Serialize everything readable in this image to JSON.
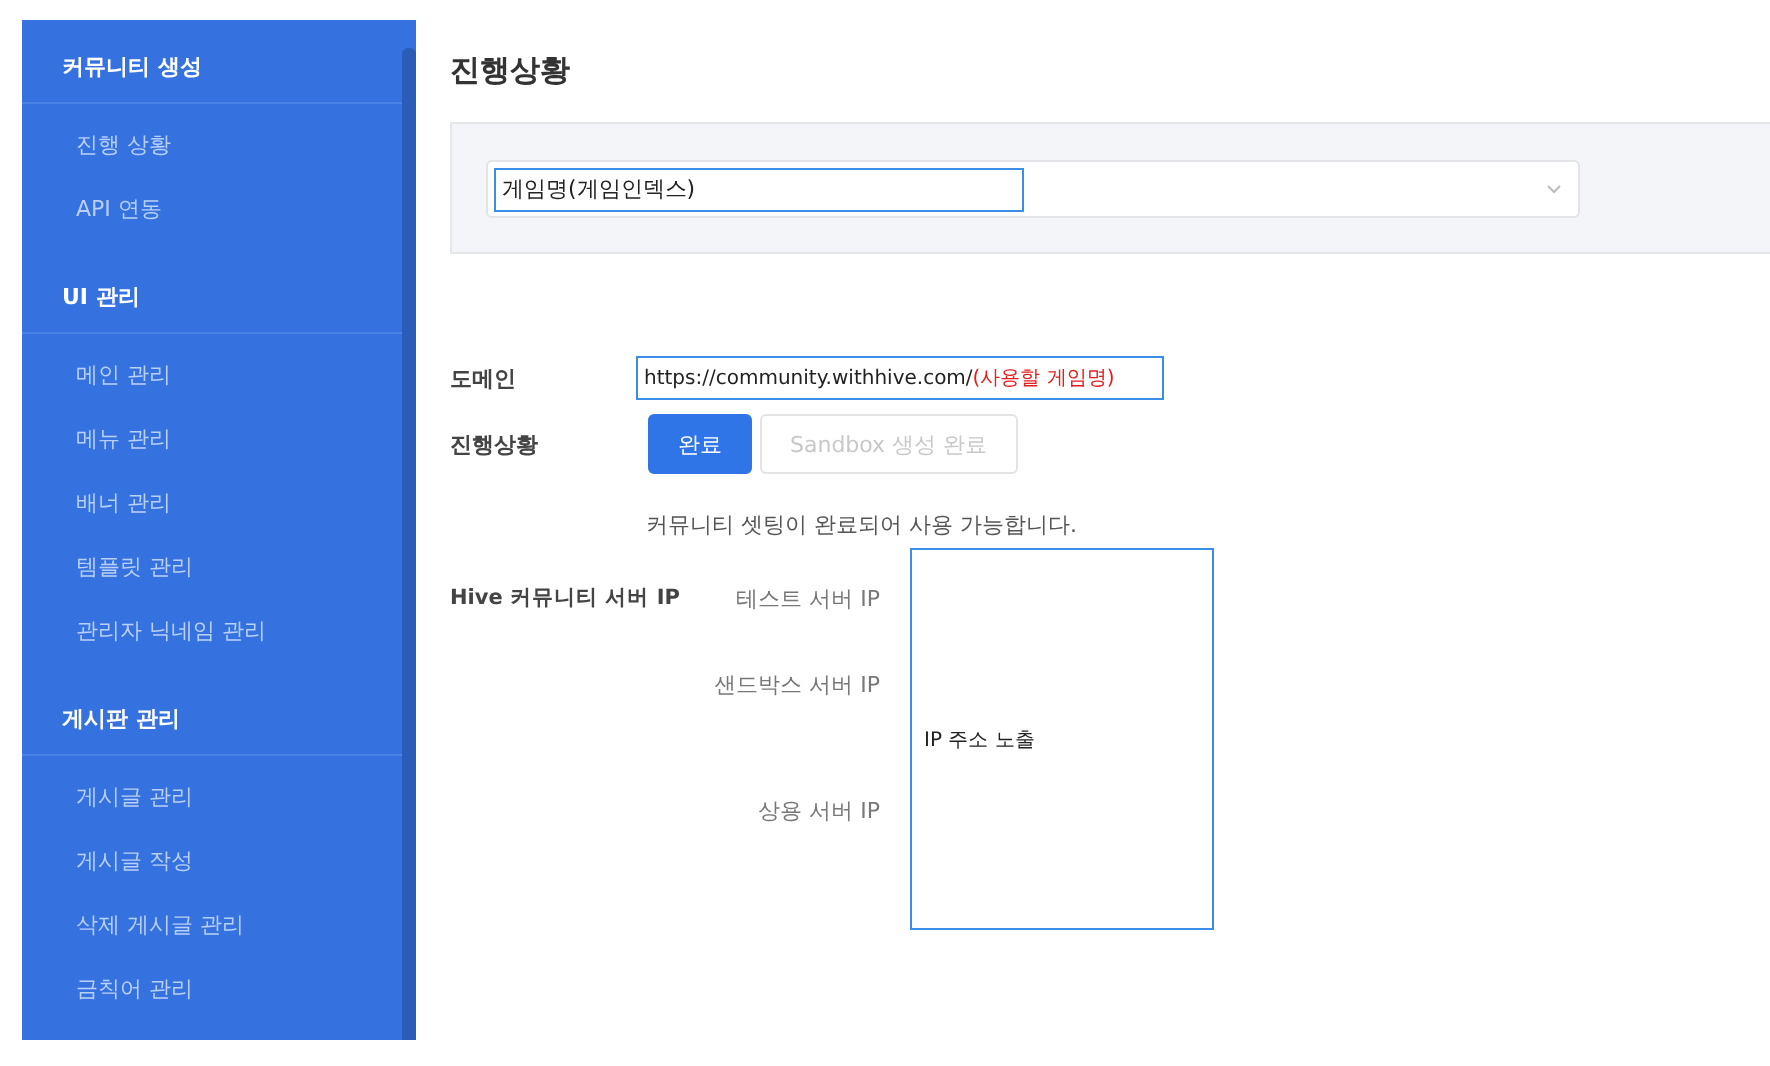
{
  "sidebar": {
    "sections": [
      {
        "title": "커뮤니티 생성",
        "items": [
          {
            "label": "진행 상황"
          },
          {
            "label": "API 연동"
          }
        ]
      },
      {
        "title": "UI 관리",
        "items": [
          {
            "label": "메인 관리"
          },
          {
            "label": "메뉴 관리"
          },
          {
            "label": "배너 관리"
          },
          {
            "label": "템플릿 관리"
          },
          {
            "label": "관리자 닉네임 관리"
          }
        ]
      },
      {
        "title": "게시판 관리",
        "items": [
          {
            "label": "게시글 관리"
          },
          {
            "label": "게시글 작성"
          },
          {
            "label": "삭제 게시글 관리"
          },
          {
            "label": "금칙어 관리"
          }
        ]
      }
    ]
  },
  "page_title": "진행상황",
  "game_select": {
    "value": "게임명(게임인덱스)"
  },
  "domain": {
    "label": "도메인",
    "url": "https://community.withhive.com/",
    "hint": "(사용할 게임명)"
  },
  "status": {
    "label": "진행상황",
    "steps": [
      {
        "label": "완료",
        "selected": true
      },
      {
        "label": "Sandbox 생성 완료",
        "selected": false
      }
    ],
    "message": "커뮤니티 셋팅이 완료되어 사용 가능합니다."
  },
  "server_ip": {
    "label": "Hive 커뮤니티 서버 IP",
    "servers": [
      "테스트 서버 IP",
      "샌드박스 서버 IP",
      "상용 서버 IP"
    ],
    "box_text": "IP 주소 노출"
  }
}
